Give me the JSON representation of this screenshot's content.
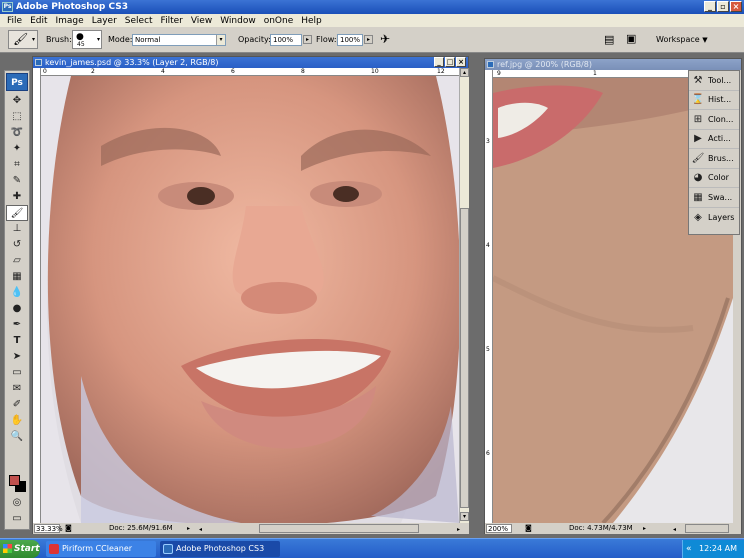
{
  "app": {
    "title": "Adobe Photoshop CS3",
    "icon": "photoshop-icon"
  },
  "menu": [
    "File",
    "Edit",
    "Image",
    "Layer",
    "Select",
    "Filter",
    "View",
    "Window",
    "onOne",
    "Help"
  ],
  "options": {
    "brush_label": "Brush:",
    "brush_size": "45",
    "mode_label": "Mode:",
    "mode_value": "Normal",
    "opacity_label": "Opacity:",
    "opacity_value": "100%",
    "flow_label": "Flow:",
    "flow_value": "100%",
    "workspace_label": "Workspace"
  },
  "toolbox": {
    "logo": "Ps",
    "tools": [
      "move-tool-icon",
      "marquee-tool-icon",
      "lasso-tool-icon",
      "magic-wand-icon",
      "crop-tool-icon",
      "slice-tool-icon",
      "healing-brush-icon",
      "brush-tool-icon",
      "clone-stamp-icon",
      "history-brush-icon",
      "eraser-tool-icon",
      "gradient-tool-icon",
      "blur-tool-icon",
      "dodge-tool-icon",
      "pen-tool-icon",
      "type-tool-icon",
      "path-select-icon",
      "shape-tool-icon",
      "notes-tool-icon",
      "eyedropper-icon",
      "hand-tool-icon",
      "zoom-tool-icon"
    ],
    "foreground_color": "#c0504d",
    "background_color": "#000000"
  },
  "doc1": {
    "title": "kevin_james.psd @ 33.3% (Layer 2, RGB/8)",
    "ruler_h": [
      "0",
      "2",
      "4",
      "6",
      "8",
      "10",
      "12"
    ],
    "ruler_v": [
      "2",
      "4",
      "6",
      "8",
      "1",
      "2",
      "4",
      "6"
    ],
    "zoom": "33.33%",
    "doc_info": "Doc: 25.6M/91.6M"
  },
  "doc2": {
    "title": "ref.jpg @ 200% (RGB/8)",
    "ruler_h": [
      "9",
      "1",
      "2"
    ],
    "ruler_v": [
      "3",
      "4",
      "5",
      "6"
    ],
    "zoom": "200%",
    "doc_info": "Doc: 4.73M/4.73M"
  },
  "dock": [
    {
      "label": "Tool...",
      "icon": "tool-presets-icon"
    },
    {
      "label": "Hist...",
      "icon": "history-icon"
    },
    {
      "label": "Clon...",
      "icon": "clone-source-icon"
    },
    {
      "label": "Acti...",
      "icon": "actions-icon"
    },
    {
      "label": "Brus...",
      "icon": "brushes-icon"
    },
    {
      "label": "Color",
      "icon": "color-icon"
    },
    {
      "label": "Swa...",
      "icon": "swatches-icon"
    },
    {
      "label": "Layers",
      "icon": "layers-icon"
    }
  ],
  "taskbar": {
    "start": "Start",
    "items": [
      {
        "label": "Piriform CCleaner",
        "active": false
      },
      {
        "label": "Adobe Photoshop CS3",
        "active": true
      }
    ],
    "clock": "12:24 AM"
  }
}
